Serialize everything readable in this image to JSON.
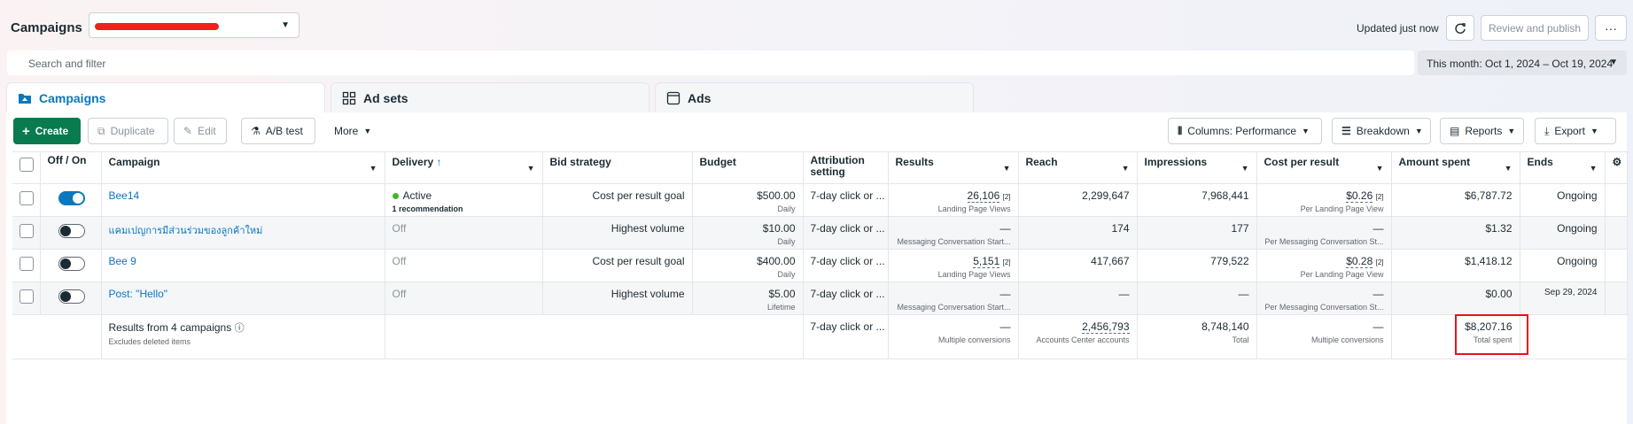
{
  "header": {
    "title": "Campaigns",
    "updated": "Updated just now",
    "publish_label": "Review and publish",
    "more_label": "···"
  },
  "search": {
    "placeholder": "Search and filter"
  },
  "date_range": {
    "label": "This month: Oct 1, 2024 – Oct 19, 2024"
  },
  "tabs": [
    {
      "label": "Campaigns",
      "active": true
    },
    {
      "label": "Ad sets",
      "active": false
    },
    {
      "label": "Ads",
      "active": false
    }
  ],
  "toolbar": {
    "create": "Create",
    "duplicate": "Duplicate",
    "edit": "Edit",
    "ab_test": "A/B test",
    "more": "More",
    "columns": "Columns: Performance",
    "breakdown": "Breakdown",
    "reports": "Reports",
    "export": "Export"
  },
  "columns": {
    "off_on": "Off / On",
    "campaign": "Campaign",
    "delivery": "Delivery",
    "bid_strategy": "Bid strategy",
    "budget": "Budget",
    "attribution": "Attribution setting",
    "results": "Results",
    "reach": "Reach",
    "impressions": "Impressions",
    "cost_per_result": "Cost per result",
    "amount_spent": "Amount spent",
    "ends": "Ends"
  },
  "rows": [
    {
      "on": true,
      "name": "Bee14",
      "delivery": "Active",
      "delivery_note": "1 recommendation",
      "bid_strategy": "Cost per result goal",
      "budget": "$500.00",
      "budget_type": "Daily",
      "attribution": "7-day click or ...",
      "results": "26,106",
      "results_type": "Landing Page Views",
      "reach": "2,299,647",
      "impressions": "7,968,441",
      "cost_per_result": "$0.26",
      "cost_type": "Per Landing Page View",
      "amount_spent": "$6,787.72",
      "ends": "Ongoing"
    },
    {
      "on": false,
      "name": "แคมเปญการมีส่วนร่วมของลูกค้าใหม่",
      "delivery": "Off",
      "delivery_note": "",
      "bid_strategy": "Highest volume",
      "budget": "$10.00",
      "budget_type": "Daily",
      "attribution": "7-day click or ...",
      "results": "—",
      "results_type": "Messaging Conversation Start...",
      "reach": "174",
      "impressions": "177",
      "cost_per_result": "—",
      "cost_type": "Per Messaging Conversation St...",
      "amount_spent": "$1.32",
      "ends": "Ongoing"
    },
    {
      "on": false,
      "name": "Bee 9",
      "delivery": "Off",
      "delivery_note": "",
      "bid_strategy": "Cost per result goal",
      "budget": "$400.00",
      "budget_type": "Daily",
      "attribution": "7-day click or ...",
      "results": "5,151",
      "results_type": "Landing Page Views",
      "reach": "417,667",
      "impressions": "779,522",
      "cost_per_result": "$0.28",
      "cost_type": "Per Landing Page View",
      "amount_spent": "$1,418.12",
      "ends": "Ongoing"
    },
    {
      "on": false,
      "name": "Post: \"Hello\"",
      "delivery": "Off",
      "delivery_note": "",
      "bid_strategy": "Highest volume",
      "budget": "$5.00",
      "budget_type": "Lifetime",
      "attribution": "7-day click or ...",
      "results": "—",
      "results_type": "Messaging Conversation Start...",
      "reach": "—",
      "impressions": "—",
      "cost_per_result": "—",
      "cost_type": "Per Messaging Conversation St...",
      "amount_spent": "$0.00",
      "ends": "Sep 29, 2024"
    }
  ],
  "summary": {
    "title": "Results from 4 campaigns",
    "subtitle": "Excludes deleted items",
    "attribution": "7-day click or ...",
    "results": "—",
    "results_type": "Multiple conversions",
    "reach": "2,456,793",
    "reach_type": "Accounts Center accounts",
    "impressions": "8,748,140",
    "impressions_type": "Total",
    "cost_per_result": "—",
    "cost_type": "Multiple conversions",
    "amount_spent": "$8,207.16",
    "amount_type": "Total spent"
  },
  "colors": {
    "accent": "#0a78be",
    "create": "#0a7a4f",
    "active_dot": "#42b72a",
    "highlight": "#e8141b"
  }
}
